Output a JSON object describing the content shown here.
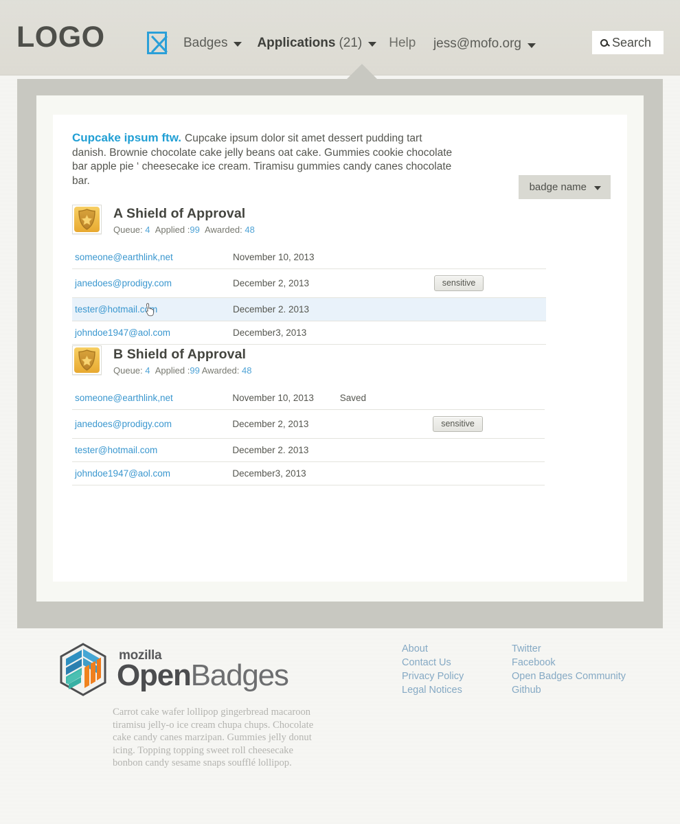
{
  "header": {
    "logo": "LOGO",
    "broken_image_icon": "broken-image-icon",
    "nav": {
      "badges": "Badges",
      "applications": "Applications",
      "applications_count": "(21)",
      "help": "Help"
    },
    "user_email": "jess@mofo.org",
    "search_label": "Search",
    "search_icon": "search-icon"
  },
  "main": {
    "intro": {
      "lead": "Cupcake ipsum ftw.",
      "body": "Cupcake ipsum dolor sit amet dessert pudding tart danish. Brownie chocolate cake jelly beans oat cake. Gummies cookie chocolate bar apple pie ‘ cheesecake ice cream. Tiramisu gummies candy canes chocolate bar."
    },
    "badge_filter": {
      "label": "badge name",
      "caret_icon": "chevron-down-icon"
    },
    "stat_labels": {
      "queue": "Queue:",
      "applied": "Applied :",
      "awarded": "Awarded:"
    },
    "groups": [
      {
        "title": "A Shield of Approval",
        "badge_icon": "shield-badge-icon",
        "queue": "4",
        "applied": "99",
        "awarded": "48",
        "rows": [
          {
            "email": "someone@earthlink,net",
            "date": "November 10, 2013",
            "status": "",
            "action": ""
          },
          {
            "email": "janedoes@prodigy.com",
            "date": "December 2, 2013",
            "status": "",
            "action": "sensitive"
          },
          {
            "email": "tester@hotmail.com",
            "date": "December 2. 2013",
            "status": "",
            "action": "",
            "hovered": true
          },
          {
            "email": "johndoe1947@aol.com",
            "date": "December3, 2013",
            "status": "",
            "action": ""
          }
        ]
      },
      {
        "title": "B Shield of Approval",
        "badge_icon": "shield-badge-icon",
        "queue": "4",
        "applied": "99",
        "awarded": "48",
        "rows": [
          {
            "email": "someone@earthlink,net",
            "date": "November 10, 2013",
            "status": "Saved",
            "action": ""
          },
          {
            "email": "janedoes@prodigy.com",
            "date": "December 2, 2013",
            "status": "",
            "action": "sensitive"
          },
          {
            "email": "tester@hotmail.com",
            "date": "December 2. 2013",
            "status": "",
            "action": ""
          },
          {
            "email": "johndoe1947@aol.com",
            "date": "December3, 2013",
            "status": "",
            "action": ""
          }
        ]
      }
    ]
  },
  "footer": {
    "brand_top": "mozilla",
    "brand_main_bold": "Open",
    "brand_main_light": "Badges",
    "brand_icon": "openbadges-hexagon-icon",
    "blurb": "Carrot cake wafer lollipop gingerbread macaroon tiramisu jelly-o ice cream chupa chups. Chocolate cake candy canes marzipan. Gummies jelly donut icing. Topping topping sweet roll cheesecake bonbon candy sesame snaps soufflé lollipop.",
    "links_col1": [
      "About",
      "Contact Us",
      "Privacy Policy",
      "Legal Notices"
    ],
    "links_col2": [
      "Twitter",
      "Facebook",
      "Open Badges Community",
      "Github"
    ]
  },
  "colors": {
    "accent_blue": "#3a97cf",
    "lead_blue": "#219fd4",
    "hover_row": "#e9f2fa",
    "panel_gray": "#c8c8c1",
    "badge_gold": "#f0b93c"
  }
}
